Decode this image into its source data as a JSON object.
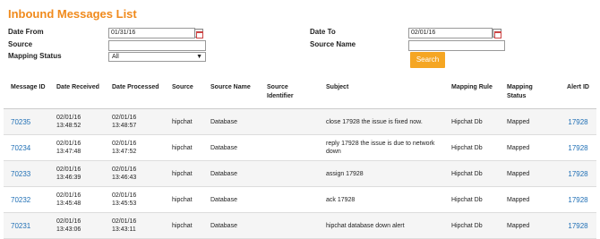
{
  "page_title": "Inbound Messages List",
  "filters": {
    "date_from_label": "Date From",
    "date_from_value": "01/31/16",
    "date_to_label": "Date To",
    "date_to_value": "02/01/16",
    "source_label": "Source",
    "source_value": "",
    "source_name_label": "Source Name",
    "source_name_value": "",
    "mapping_status_label": "Mapping Status",
    "mapping_status_value": "All",
    "search_label": "Search"
  },
  "table": {
    "headers": [
      "Message ID",
      "Date Received",
      "Date Processed",
      "Source",
      "Source Name",
      "Source Identifier",
      "Subject",
      "Mapping Rule",
      "Mapping Status",
      "Alert ID"
    ],
    "rows": [
      {
        "id": "70235",
        "received": "02/01/16 13:48:52",
        "processed": "02/01/16 13:48:57",
        "source": "hipchat",
        "source_name": "Database",
        "identifier": "",
        "subject": "close 17928 the issue is fixed now.",
        "rule": "Hipchat Db",
        "status": "Mapped",
        "alert": "17928"
      },
      {
        "id": "70234",
        "received": "02/01/16 13:47:48",
        "processed": "02/01/16 13:47:52",
        "source": "hipchat",
        "source_name": "Database",
        "identifier": "",
        "subject": "reply 17928 the issue is due to network down",
        "rule": "Hipchat Db",
        "status": "Mapped",
        "alert": "17928"
      },
      {
        "id": "70233",
        "received": "02/01/16 13:46:39",
        "processed": "02/01/16 13:46:43",
        "source": "hipchat",
        "source_name": "Database",
        "identifier": "",
        "subject": "assign 17928",
        "rule": "Hipchat Db",
        "status": "Mapped",
        "alert": "17928"
      },
      {
        "id": "70232",
        "received": "02/01/16 13:45:48",
        "processed": "02/01/16 13:45:53",
        "source": "hipchat",
        "source_name": "Database",
        "identifier": "",
        "subject": "ack 17928",
        "rule": "Hipchat Db",
        "status": "Mapped",
        "alert": "17928"
      },
      {
        "id": "70231",
        "received": "02/01/16 13:43:06",
        "processed": "02/01/16 13:43:11",
        "source": "hipchat",
        "source_name": "Database",
        "identifier": "",
        "subject": "hipchat database down alert",
        "rule": "Hipchat Db",
        "status": "Mapped",
        "alert": "17928"
      }
    ]
  }
}
